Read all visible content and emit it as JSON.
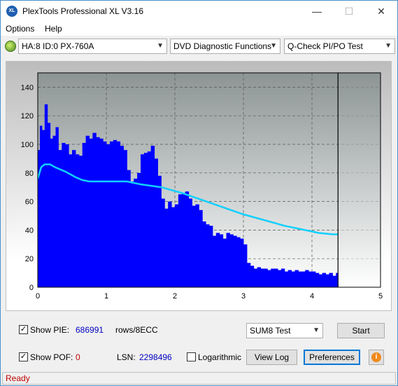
{
  "window": {
    "title": "PlexTools Professional XL V3.16",
    "icon_label": "XL",
    "minimize": "—",
    "maximize": "☐",
    "close": "✕"
  },
  "menu": {
    "options": "Options",
    "help": "Help"
  },
  "toolbar": {
    "drive": "HA:8 ID:0  PX-760A",
    "function": "DVD Diagnostic Functions",
    "test": "Q-Check PI/PO Test"
  },
  "chart_data": {
    "type": "area",
    "x_ticks": [
      "0",
      "1",
      "2",
      "3",
      "4",
      "5"
    ],
    "y_ticks": [
      "0",
      "20",
      "40",
      "60",
      "80",
      "100",
      "120",
      "140"
    ],
    "xlim": [
      0,
      5
    ],
    "ylim": [
      0,
      150
    ],
    "grid": true,
    "end_marker_x": 4.38,
    "series": [
      {
        "kind": "bars",
        "color": "#0000ff",
        "points": [
          [
            0.0,
            96
          ],
          [
            0.03,
            113
          ],
          [
            0.06,
            110
          ],
          [
            0.1,
            128
          ],
          [
            0.14,
            115
          ],
          [
            0.18,
            104
          ],
          [
            0.22,
            106
          ],
          [
            0.26,
            112
          ],
          [
            0.3,
            96
          ],
          [
            0.35,
            101
          ],
          [
            0.4,
            100
          ],
          [
            0.45,
            93
          ],
          [
            0.5,
            96
          ],
          [
            0.55,
            93
          ],
          [
            0.6,
            92
          ],
          [
            0.65,
            101
          ],
          [
            0.7,
            106
          ],
          [
            0.75,
            104
          ],
          [
            0.8,
            108
          ],
          [
            0.85,
            105
          ],
          [
            0.9,
            104
          ],
          [
            0.95,
            102
          ],
          [
            1.0,
            100
          ],
          [
            1.05,
            102
          ],
          [
            1.1,
            103
          ],
          [
            1.15,
            102
          ],
          [
            1.2,
            99
          ],
          [
            1.25,
            96
          ],
          [
            1.3,
            82
          ],
          [
            1.35,
            74
          ],
          [
            1.4,
            76
          ],
          [
            1.45,
            80
          ],
          [
            1.5,
            93
          ],
          [
            1.55,
            94
          ],
          [
            1.6,
            95
          ],
          [
            1.65,
            99
          ],
          [
            1.7,
            90
          ],
          [
            1.75,
            78
          ],
          [
            1.8,
            62
          ],
          [
            1.85,
            55
          ],
          [
            1.9,
            60
          ],
          [
            1.95,
            56
          ],
          [
            2.0,
            58
          ],
          [
            2.05,
            65
          ],
          [
            2.1,
            66
          ],
          [
            2.15,
            67
          ],
          [
            2.2,
            62
          ],
          [
            2.25,
            57
          ],
          [
            2.3,
            58
          ],
          [
            2.35,
            54
          ],
          [
            2.4,
            46
          ],
          [
            2.45,
            44
          ],
          [
            2.5,
            43
          ],
          [
            2.55,
            36
          ],
          [
            2.6,
            38
          ],
          [
            2.65,
            37
          ],
          [
            2.7,
            34
          ],
          [
            2.75,
            38
          ],
          [
            2.8,
            37
          ],
          [
            2.85,
            36
          ],
          [
            2.9,
            35
          ],
          [
            2.95,
            34
          ],
          [
            3.0,
            30
          ],
          [
            3.05,
            17
          ],
          [
            3.1,
            15
          ],
          [
            3.15,
            13
          ],
          [
            3.2,
            14
          ],
          [
            3.25,
            13
          ],
          [
            3.3,
            13
          ],
          [
            3.35,
            12
          ],
          [
            3.4,
            13
          ],
          [
            3.45,
            13
          ],
          [
            3.5,
            12
          ],
          [
            3.55,
            13
          ],
          [
            3.6,
            11
          ],
          [
            3.65,
            12
          ],
          [
            3.7,
            11
          ],
          [
            3.75,
            12
          ],
          [
            3.8,
            11
          ],
          [
            3.85,
            11
          ],
          [
            3.9,
            12
          ],
          [
            3.95,
            11
          ],
          [
            4.0,
            11
          ],
          [
            4.05,
            10
          ],
          [
            4.1,
            9
          ],
          [
            4.15,
            10
          ],
          [
            4.2,
            9
          ],
          [
            4.25,
            10
          ],
          [
            4.3,
            8
          ],
          [
            4.35,
            10
          ]
        ]
      },
      {
        "kind": "line",
        "color": "#10d0ff",
        "points": [
          [
            0.0,
            76
          ],
          [
            0.05,
            84
          ],
          [
            0.1,
            86
          ],
          [
            0.18,
            86
          ],
          [
            0.25,
            84
          ],
          [
            0.4,
            81
          ],
          [
            0.55,
            77
          ],
          [
            0.65,
            75
          ],
          [
            0.75,
            74
          ],
          [
            0.9,
            74
          ],
          [
            1.1,
            74
          ],
          [
            1.3,
            74
          ],
          [
            1.5,
            72
          ],
          [
            1.8,
            70
          ],
          [
            2.1,
            66
          ],
          [
            2.4,
            61
          ],
          [
            2.7,
            56
          ],
          [
            3.0,
            51
          ],
          [
            3.3,
            47
          ],
          [
            3.6,
            43
          ],
          [
            3.9,
            40
          ],
          [
            4.1,
            38
          ],
          [
            4.3,
            37
          ],
          [
            4.38,
            37
          ]
        ]
      }
    ]
  },
  "controls": {
    "show_pie_label": "Show PIE:",
    "show_pie_checked": "✓",
    "pie_value": "686991",
    "pie_unit": "rows/8ECC",
    "show_pof_label": "Show POF:",
    "show_pof_checked": "✓",
    "pof_value": "0",
    "lsn_label": "LSN:",
    "lsn_value": "2298496",
    "logarithmic_label": "Logarithmic",
    "test_mode": "SUM8 Test",
    "start_button": "Start",
    "view_log_button": "View Log",
    "preferences_button": "Preferences",
    "info_glyph": "i"
  },
  "status": {
    "text": "Ready"
  }
}
